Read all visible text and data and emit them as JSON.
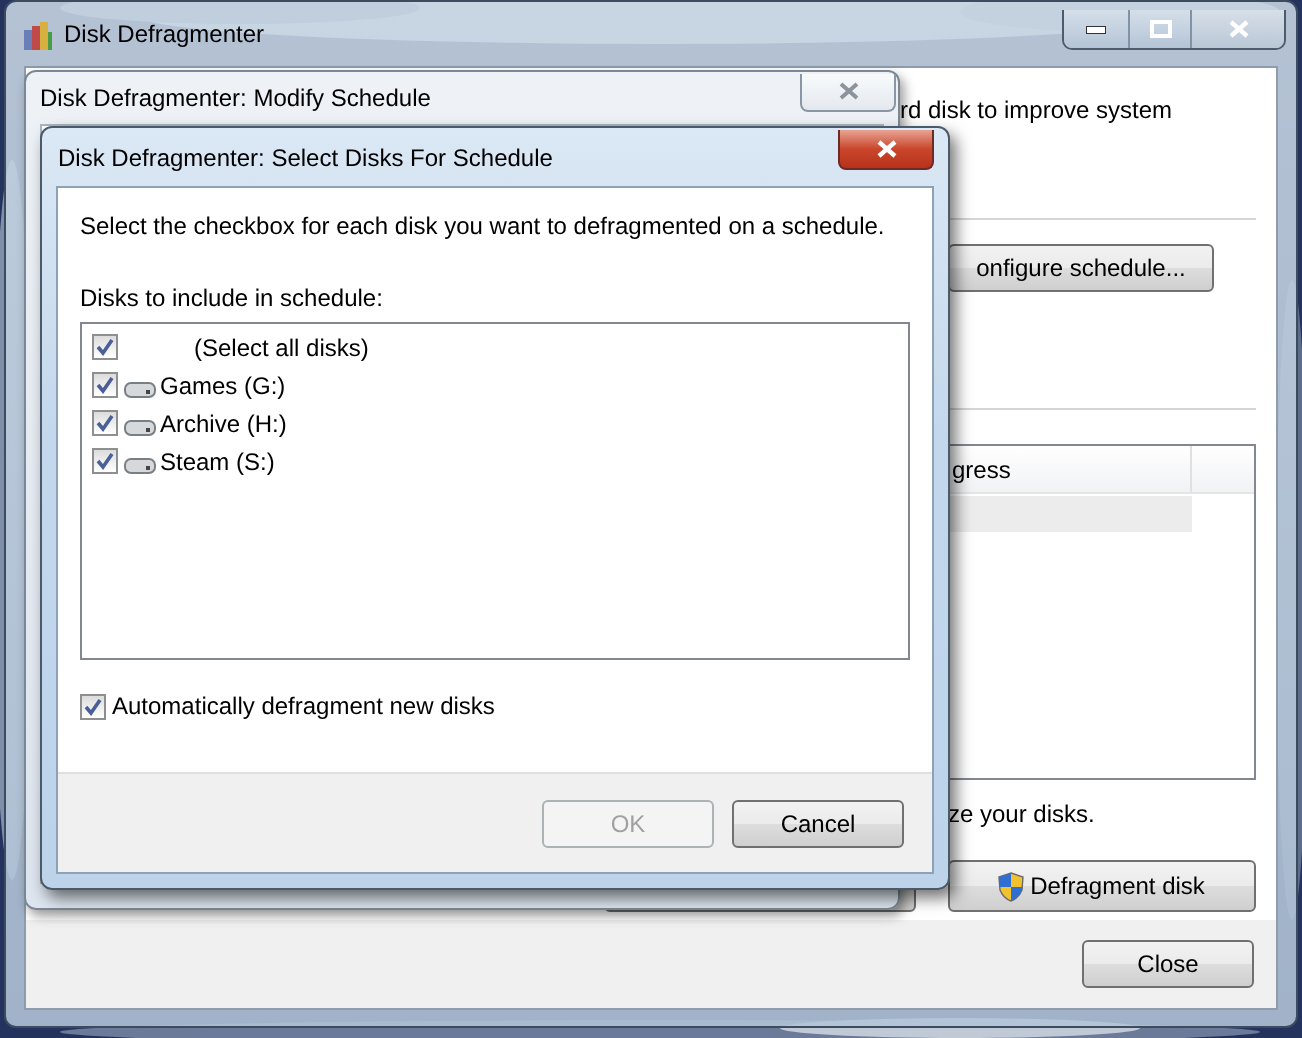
{
  "main_window": {
    "title": "Disk Defragmenter",
    "description_fragment": "rd disk to improve system",
    "configure_button": "onfigure schedule...",
    "column_header": "gress",
    "status_fragment": "ze your disks.",
    "defragment_button": "Defragment disk",
    "close_button": "Close"
  },
  "modify_dialog": {
    "title": "Disk Defragmenter: Modify Schedule"
  },
  "select_dialog": {
    "title": "Disk Defragmenter: Select Disks For Schedule",
    "instruction": "Select the checkbox for each disk you want to defragmented on a schedule.",
    "list_label": "Disks to include in schedule:",
    "disks": [
      {
        "label": "(Select all disks)",
        "kind": "all",
        "checked": true
      },
      {
        "label": "Games (G:)",
        "kind": "drive",
        "checked": true
      },
      {
        "label": "Archive (H:)",
        "kind": "drive",
        "checked": true
      },
      {
        "label": "Steam (S:)",
        "kind": "drive",
        "checked": true
      }
    ],
    "auto_defrag": {
      "label": "Automatically defragment new disks",
      "checked": true
    },
    "ok_button": {
      "label": "OK",
      "disabled": true
    },
    "cancel_button": {
      "label": "Cancel",
      "disabled": false
    }
  }
}
